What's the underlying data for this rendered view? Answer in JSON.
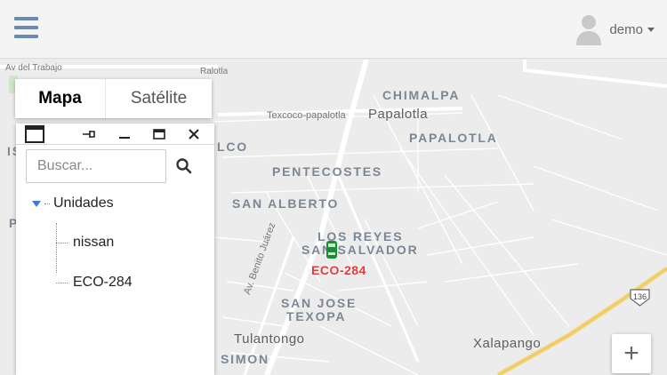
{
  "topbar": {
    "menu_icon": "hamburger-icon",
    "user_icon": "user-avatar-icon",
    "user_name": "demo"
  },
  "map": {
    "type_control": {
      "map_label": "Mapa",
      "satellite_label": "Satélite",
      "selected": "Mapa"
    },
    "zoom_in_label": "+",
    "route_shield": "136",
    "road_labels": {
      "trabajo": "Av del Trabajo",
      "texcoco": "Texcoco-papalotla",
      "benito": "Av. Benito Juárez",
      "aztlan": "Ralotla"
    },
    "places": {
      "chimalpa": "CHIMALPA",
      "papalotla_town": "Papalotla",
      "papalotla": "PAPALOTLA",
      "pentecostes": "PENTECOSTES",
      "san_alberto": "SAN ALBERTO",
      "los_reyes": "LOS REYES",
      "san_salvador": "SAN SALVADOR",
      "san_jose": "SAN JOSE",
      "texopa": "TEXOPA",
      "tulantongo": "Tulantongo",
      "simon": "SIMON",
      "xalapango": "Xalapango",
      "frag_lco": "LCO",
      "frag_is": "IS",
      "frag_p": "P"
    },
    "vehicle": {
      "label": "ECO-284",
      "color": "#1e8a3a",
      "label_color": "#e23a3a"
    }
  },
  "panel": {
    "header_icons": [
      "window-icon",
      "pin-icon",
      "minimize-icon",
      "maximize-icon",
      "close-icon"
    ],
    "search_placeholder": "Buscar...",
    "search_value": "",
    "tree": {
      "root_label": "Unidades",
      "items": [
        {
          "label": "nissan"
        },
        {
          "label": "ECO-284"
        }
      ]
    }
  }
}
